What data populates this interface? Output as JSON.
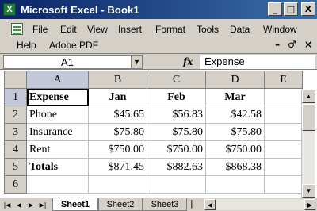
{
  "window": {
    "title": "Microsoft Excel - Book1",
    "app_icon_glyph": "X",
    "minimize_glyph": "_",
    "maximize_glyph": "□",
    "close_glyph": "X"
  },
  "menu": {
    "row1": [
      "File",
      "Edit",
      "View",
      "Insert",
      "Format",
      "Tools",
      "Data",
      "Window"
    ],
    "row2": [
      "Help",
      "Adobe PDF"
    ],
    "doc_minimize_glyph": "–",
    "doc_restore_glyph": "♂",
    "doc_close_glyph": "×"
  },
  "formula_bar": {
    "name_box": "A1",
    "fx_label": "fx",
    "content": "Expense"
  },
  "grid": {
    "columns": [
      "A",
      "B",
      "C",
      "D",
      "E"
    ],
    "rows": [
      {
        "num": "1",
        "cells": [
          "Expense",
          "Jan",
          "Feb",
          "Mar",
          ""
        ]
      },
      {
        "num": "2",
        "cells": [
          "Phone",
          "$45.65",
          "$56.83",
          "$42.58",
          ""
        ]
      },
      {
        "num": "3",
        "cells": [
          "Insurance",
          "$75.80",
          "$75.80",
          "$75.80",
          ""
        ]
      },
      {
        "num": "4",
        "cells": [
          "Rent",
          "$750.00",
          "$750.00",
          "$750.00",
          ""
        ]
      },
      {
        "num": "5",
        "cells": [
          "Totals",
          "$871.45",
          "$882.63",
          "$868.38",
          ""
        ]
      },
      {
        "num": "6",
        "cells": [
          "",
          "",
          "",
          "",
          ""
        ]
      }
    ]
  },
  "tabs": {
    "sheets": [
      "Sheet1",
      "Sheet2",
      "Sheet3"
    ],
    "active": "Sheet1"
  },
  "colors": {
    "titlebar_start": "#0a246a",
    "titlebar_end": "#3a6ea5",
    "chrome": "#d4d0c8",
    "selected_header": "#c2c8d8"
  }
}
